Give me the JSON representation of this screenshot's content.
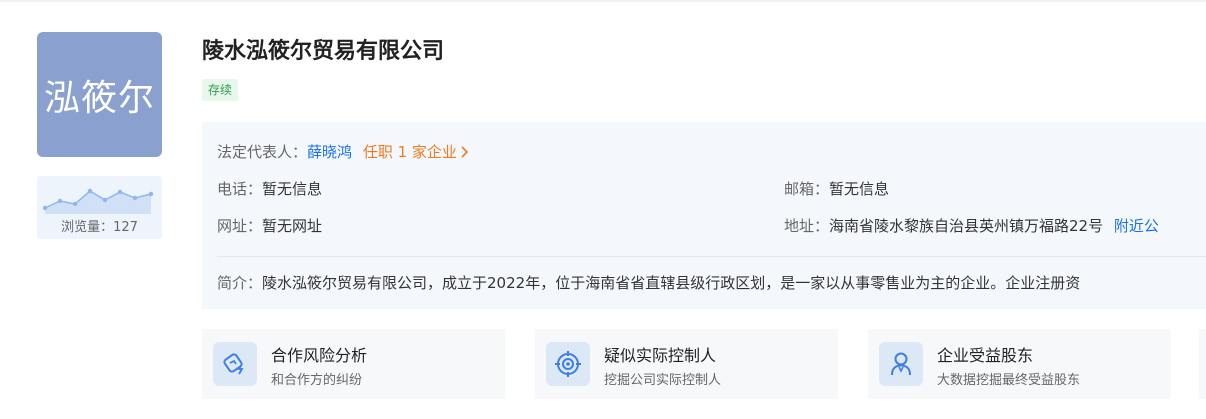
{
  "company": {
    "logo_text": "泓筱尔",
    "name": "陵水泓筱尔贸易有限公司",
    "status": "存续",
    "views_label": "浏览量：127"
  },
  "info": {
    "legal_rep_label": "法定代表人：",
    "legal_rep_name": "薛晓鸿",
    "legal_rep_positions": "任职 1 家企业",
    "phone_label": "电话：",
    "phone_value": "暂无信息",
    "email_label": "邮箱：",
    "email_value": "暂无信息",
    "website_label": "网址：",
    "website_value": "暂无网址",
    "address_label": "地址：",
    "address_value": "海南省陵水黎族自治县英州镇万福路22号",
    "address_link": "附近公",
    "intro_label": "简介：",
    "intro_text": "陵水泓筱尔贸易有限公司，成立于2022年，位于海南省省直辖县级行政区划，是一家以从事零售业为主的企业。企业注册资"
  },
  "cards": [
    {
      "title": "合作风险分析",
      "subtitle": "和合作方的纠纷",
      "icon": "handshake-risk-icon"
    },
    {
      "title": "疑似实际控制人",
      "subtitle": "挖掘公司实际控制人",
      "icon": "target-control-icon"
    },
    {
      "title": "企业受益股东",
      "subtitle": "大数据挖掘最终受益股东",
      "icon": "beneficiary-person-icon"
    }
  ],
  "colors": {
    "logo_bg": "#8aa0cf",
    "link": "#1a73e8",
    "orange": "#f07a22",
    "status_green": "#2e9d4e",
    "panel_bg": "#f4f8fd"
  }
}
